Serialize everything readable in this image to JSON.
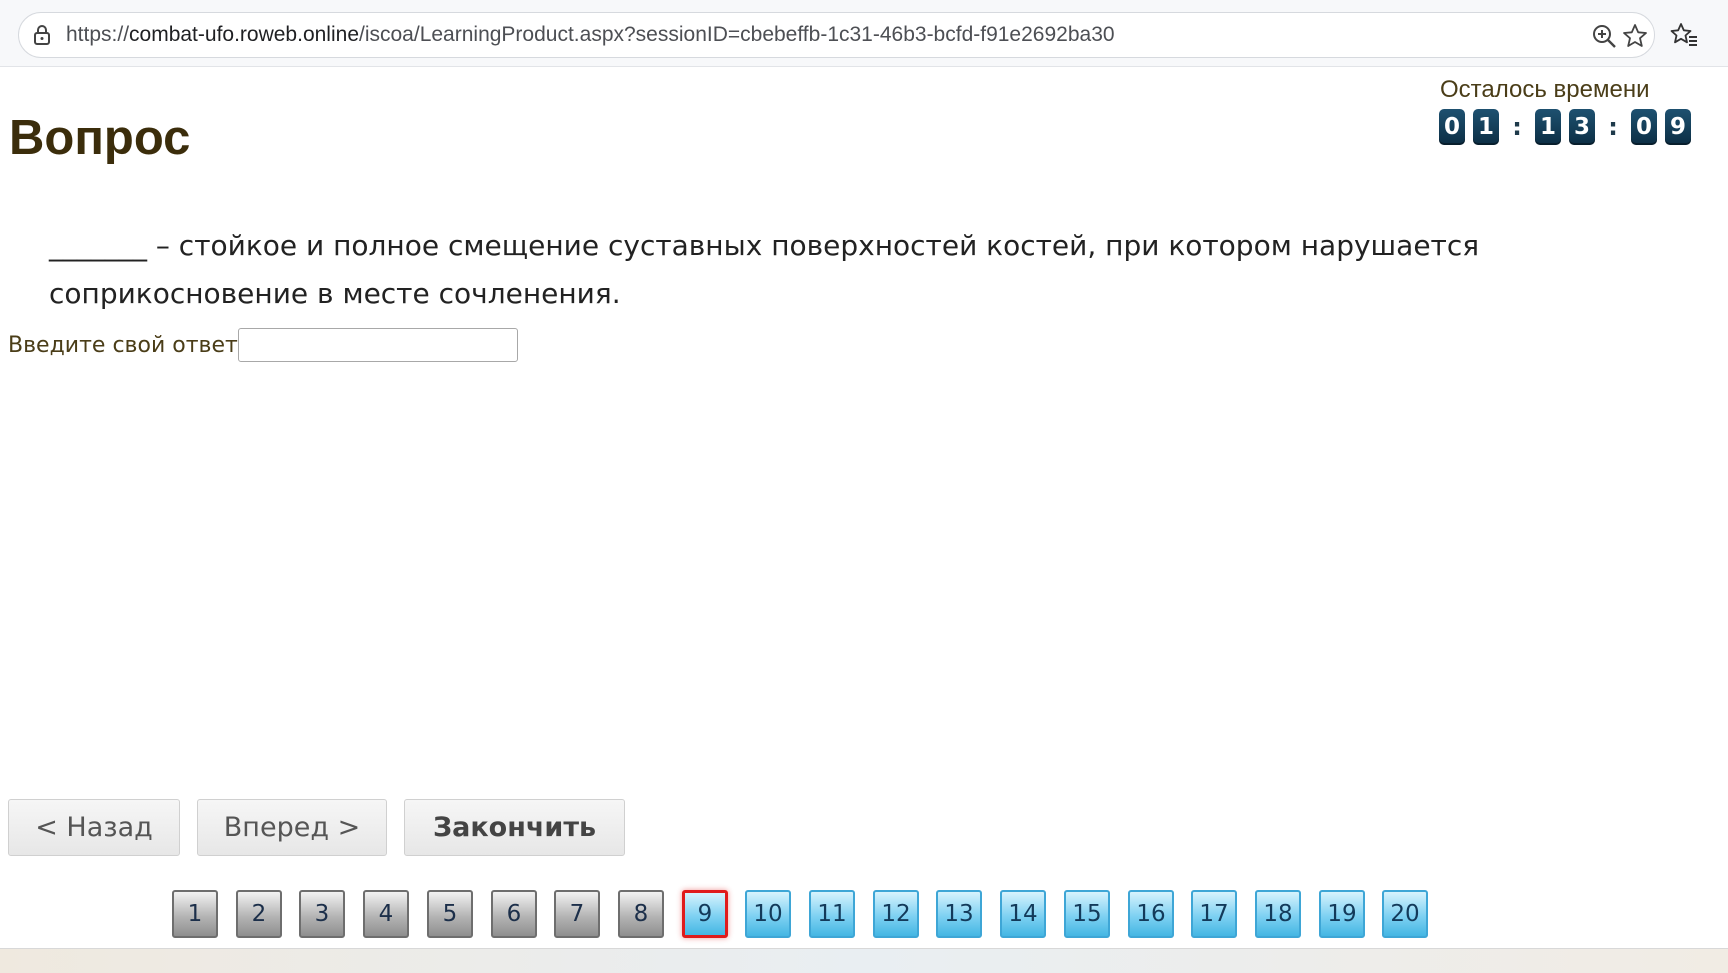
{
  "browser": {
    "url_prefix": "https://",
    "url_host": "combat-ufo.roweb.online",
    "url_rest": "/iscoa/LearningProduct.aspx?sessionID=cbebeffb-1c31-46b3-bcfd-f91e2692ba30",
    "icons": [
      "lock-icon",
      "zoom-icon",
      "star-icon",
      "favorites-icon"
    ]
  },
  "timer": {
    "label": "Осталось времени",
    "hours": [
      "0",
      "1"
    ],
    "minutes": [
      "1",
      "3"
    ],
    "seconds": [
      "0",
      "9"
    ],
    "separator": ":"
  },
  "question": {
    "title": "Вопрос",
    "text": "_______ – стойкое и полное смещение суставных поверхностей костей, при котором нарушается соприкосновение в месте сочленения.",
    "answer_label": "Введите свой ответ",
    "answer_value": ""
  },
  "navigation": {
    "back_label": "< Назад",
    "forward_label": "Вперед >",
    "finish_label": "Закончить"
  },
  "pager": {
    "current": 9,
    "pages": [
      "1",
      "2",
      "3",
      "4",
      "5",
      "6",
      "7",
      "8",
      "9",
      "10",
      "11",
      "12",
      "13",
      "14",
      "15",
      "16",
      "17",
      "18",
      "19",
      "20"
    ],
    "colors": {
      "done": "#9a9a9a",
      "todo": "#6cc8ee",
      "current_border": "#e01b1b"
    }
  }
}
